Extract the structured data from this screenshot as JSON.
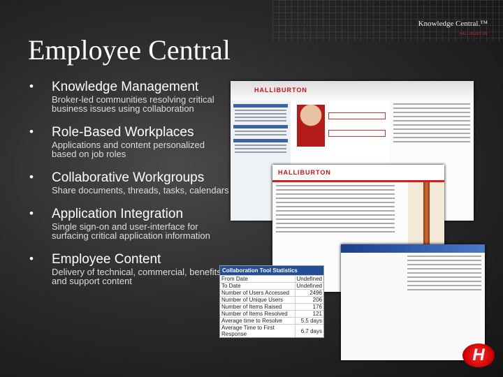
{
  "brand": {
    "name": "Knowledge Central.™",
    "sub": "HALLIBURTON"
  },
  "title": "Employee Central",
  "bullets": [
    {
      "heading": "Knowledge Management",
      "sub": "Broker-led communities resolving critical business issues using collaboration"
    },
    {
      "heading": "Role-Based Workplaces",
      "sub": "Applications and content personalized based on job roles"
    },
    {
      "heading": "Collaborative Workgroups",
      "sub": "Share documents, threads, tasks, calendars"
    },
    {
      "heading": "Application Integration",
      "sub": "Single sign-on and user-interface for surfacing critical application information"
    },
    {
      "heading": "Employee Content",
      "sub": "Delivery of technical, commercial, benefits and support content"
    }
  ],
  "screens": {
    "logo": "HALLIBURTON"
  },
  "stats": {
    "caption": "Collaboration Tool Statistics",
    "rows": [
      {
        "label": "From Date",
        "value": "Undefined"
      },
      {
        "label": "To Date",
        "value": "Undefined"
      },
      {
        "label": "Number of Users Accessed",
        "value": "2496"
      },
      {
        "label": "Number of Unique Users",
        "value": "206"
      },
      {
        "label": "Number of Items Raised",
        "value": "176"
      },
      {
        "label": "Number of Items Resolved",
        "value": "121"
      },
      {
        "label": "Average time to Resolve",
        "value": "5.5 days"
      },
      {
        "label": "Average Time to First Response",
        "value": "6.7 days"
      }
    ]
  },
  "footer_logo": "H",
  "colors": {
    "accent": "#c11",
    "table_header": "#244f96"
  }
}
